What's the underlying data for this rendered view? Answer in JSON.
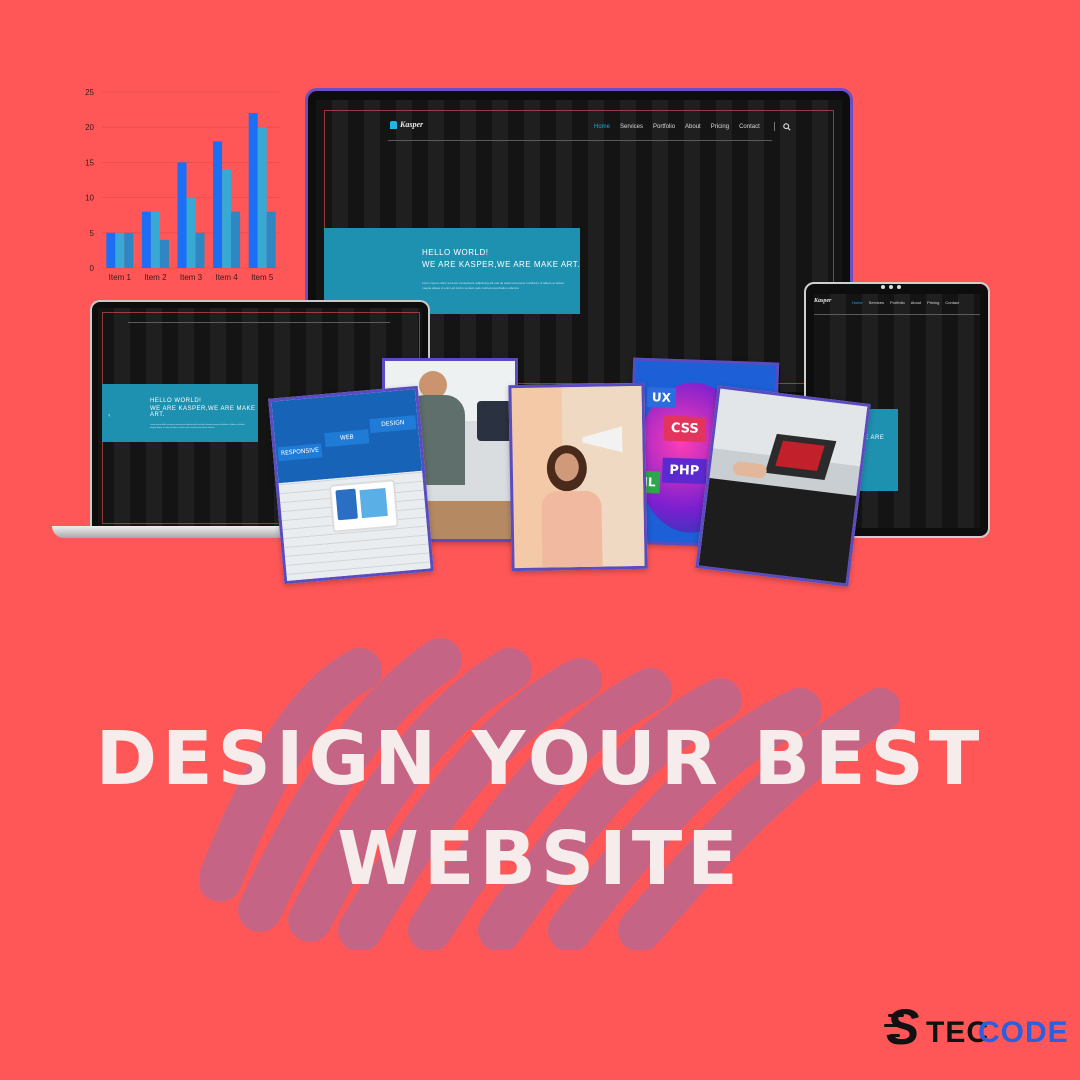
{
  "background_color": "#ff5757",
  "chart_data": {
    "type": "bar",
    "categories": [
      "Item 1",
      "Item 2",
      "Item 3",
      "Item 4",
      "Item 5"
    ],
    "series": [
      {
        "values": [
          5,
          8,
          15,
          18,
          22
        ],
        "color": "#1a6ff5"
      },
      {
        "values": [
          5,
          8,
          10,
          14,
          20
        ],
        "color": "#37a9d4"
      },
      {
        "values": [
          5,
          4,
          5,
          8,
          8
        ],
        "color": "#2e86c2"
      }
    ],
    "yticks": [
      "0",
      "5",
      "10",
      "15",
      "20",
      "25"
    ],
    "ylim": [
      0,
      25
    ],
    "grid": true
  },
  "site": {
    "logo": "Kasper",
    "nav": [
      "Home",
      "Services",
      "Portfolio",
      "About",
      "Pricing",
      "Contact"
    ],
    "active_nav": "Home",
    "hero_line1": "HELLO WORLD!",
    "hero_line2": "WE ARE KASPER,WE ARE MAKE ART.",
    "hero_paragraph": "Lorem ipsum dolor sit amet consectetur adipiscing elit sed do eiusmod tempor incididunt ut labore et dolore magna aliqua ut enim ad minim veniam quis nostrud exercitation ullamco.",
    "tablet_hero_fragment": "WE ARE"
  },
  "photos": {
    "responsive_tiles": [
      "RESPONSIVE",
      "WEB",
      "DESIGN"
    ],
    "code_words": [
      "UX",
      "CSS",
      "PHP",
      "ML"
    ]
  },
  "headline": {
    "line1": "DESIGN YOUR BEST",
    "line2": "WEBSITE"
  },
  "brand": {
    "initial": "S",
    "part1": "TEC",
    "part2": "CODE",
    "color_dark": "#111111",
    "color_accent": "#2a5fe0"
  }
}
